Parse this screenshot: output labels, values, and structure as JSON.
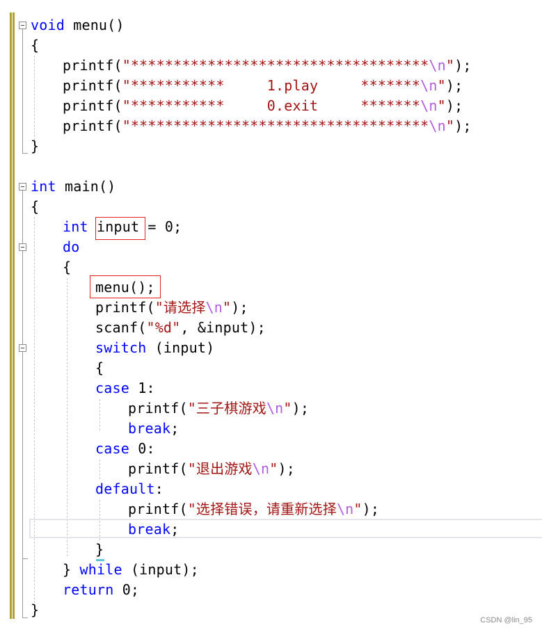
{
  "code_lines": [
    {
      "tokens": [
        {
          "t": "kw",
          "v": "void"
        },
        {
          "t": "p",
          "v": " menu()"
        }
      ]
    },
    {
      "tokens": [
        {
          "t": "p",
          "v": "{"
        }
      ]
    },
    {
      "tokens": [
        {
          "t": "p",
          "v": "printf("
        },
        {
          "t": "str",
          "v": "\"***********************************"
        },
        {
          "t": "esc",
          "v": "\\n"
        },
        {
          "t": "str",
          "v": "\""
        },
        {
          "t": "p",
          "v": ");"
        }
      ]
    },
    {
      "tokens": [
        {
          "t": "p",
          "v": "printf("
        },
        {
          "t": "str",
          "v": "\"***********     1.play     *******"
        },
        {
          "t": "esc",
          "v": "\\n"
        },
        {
          "t": "str",
          "v": "\""
        },
        {
          "t": "p",
          "v": ");"
        }
      ]
    },
    {
      "tokens": [
        {
          "t": "p",
          "v": "printf("
        },
        {
          "t": "str",
          "v": "\"***********     0.exit     *******"
        },
        {
          "t": "esc",
          "v": "\\n"
        },
        {
          "t": "str",
          "v": "\""
        },
        {
          "t": "p",
          "v": ");"
        }
      ]
    },
    {
      "tokens": [
        {
          "t": "p",
          "v": "printf("
        },
        {
          "t": "str",
          "v": "\"***********************************"
        },
        {
          "t": "esc",
          "v": "\\n"
        },
        {
          "t": "str",
          "v": "\""
        },
        {
          "t": "p",
          "v": ");"
        }
      ]
    },
    {
      "tokens": [
        {
          "t": "p",
          "v": "}"
        }
      ]
    },
    {
      "tokens": []
    },
    {
      "tokens": [
        {
          "t": "kw",
          "v": "int"
        },
        {
          "t": "p",
          "v": " main()"
        }
      ]
    },
    {
      "tokens": [
        {
          "t": "p",
          "v": "{"
        }
      ]
    },
    {
      "tokens": [
        {
          "t": "kw",
          "v": "int"
        },
        {
          "t": "p",
          "v": " input = 0;"
        }
      ]
    },
    {
      "tokens": [
        {
          "t": "kw",
          "v": "do"
        }
      ]
    },
    {
      "tokens": [
        {
          "t": "p",
          "v": "{"
        }
      ]
    },
    {
      "tokens": [
        {
          "t": "p",
          "v": "menu();"
        }
      ]
    },
    {
      "tokens": [
        {
          "t": "p",
          "v": "printf("
        },
        {
          "t": "str",
          "v": "\"请选择"
        },
        {
          "t": "esc",
          "v": "\\n"
        },
        {
          "t": "str",
          "v": "\""
        },
        {
          "t": "p",
          "v": ");"
        }
      ]
    },
    {
      "tokens": [
        {
          "t": "p",
          "v": "scanf("
        },
        {
          "t": "str",
          "v": "\"%d\""
        },
        {
          "t": "p",
          "v": ", &input);"
        }
      ]
    },
    {
      "tokens": [
        {
          "t": "kw",
          "v": "switch"
        },
        {
          "t": "p",
          "v": " (input)"
        }
      ]
    },
    {
      "tokens": [
        {
          "t": "p",
          "v": "{"
        }
      ]
    },
    {
      "tokens": [
        {
          "t": "kw",
          "v": "case"
        },
        {
          "t": "p",
          "v": " 1:"
        }
      ]
    },
    {
      "tokens": [
        {
          "t": "p",
          "v": "printf("
        },
        {
          "t": "str",
          "v": "\"三子棋游戏"
        },
        {
          "t": "esc",
          "v": "\\n"
        },
        {
          "t": "str",
          "v": "\""
        },
        {
          "t": "p",
          "v": ");"
        }
      ]
    },
    {
      "tokens": [
        {
          "t": "kw",
          "v": "break"
        },
        {
          "t": "p",
          "v": ";"
        }
      ]
    },
    {
      "tokens": [
        {
          "t": "kw",
          "v": "case"
        },
        {
          "t": "p",
          "v": " 0:"
        }
      ]
    },
    {
      "tokens": [
        {
          "t": "p",
          "v": "printf("
        },
        {
          "t": "str",
          "v": "\"退出游戏"
        },
        {
          "t": "esc",
          "v": "\\n"
        },
        {
          "t": "str",
          "v": "\""
        },
        {
          "t": "p",
          "v": ");"
        }
      ]
    },
    {
      "tokens": [
        {
          "t": "kw",
          "v": "default"
        },
        {
          "t": "p",
          "v": ":"
        }
      ]
    },
    {
      "tokens": [
        {
          "t": "p",
          "v": "printf("
        },
        {
          "t": "str",
          "v": "\"选择错误，请重新选择"
        },
        {
          "t": "esc",
          "v": "\\n"
        },
        {
          "t": "str",
          "v": "\""
        },
        {
          "t": "p",
          "v": ");"
        }
      ]
    },
    {
      "tokens": [
        {
          "t": "kw",
          "v": "break"
        },
        {
          "t": "p",
          "v": ";"
        }
      ]
    },
    {
      "tokens": [
        {
          "t": "p",
          "v": "}"
        }
      ]
    },
    {
      "tokens": [
        {
          "t": "p",
          "v": "} "
        },
        {
          "t": "kw",
          "v": "while"
        },
        {
          "t": "p",
          "v": " (input);"
        }
      ]
    },
    {
      "tokens": [
        {
          "t": "kw",
          "v": "return"
        },
        {
          "t": "p",
          "v": " 0;"
        }
      ]
    },
    {
      "tokens": [
        {
          "t": "p",
          "v": "}"
        }
      ]
    }
  ],
  "colors": {
    "keyword": "#0000ff",
    "string": "#a31515",
    "escape": "#b05be0",
    "highlight_box": "#e02020"
  },
  "watermark": "CSDN @lin_95"
}
